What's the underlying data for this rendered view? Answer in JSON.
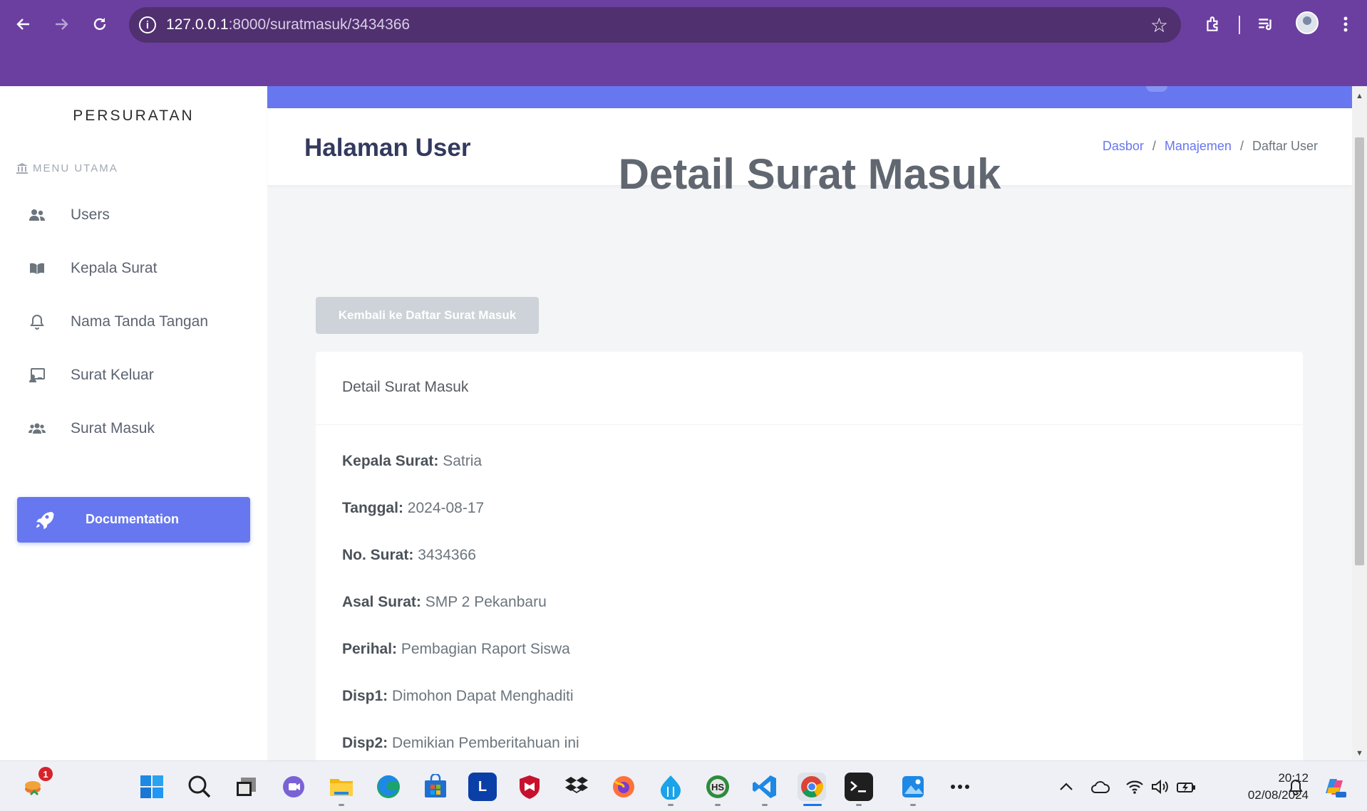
{
  "browser": {
    "url_host": "127.0.0.1",
    "url_path": ":8000/suratmasuk/3434366"
  },
  "sidebar": {
    "brand": "PERSURATAN",
    "menu_title": "MENU UTAMA",
    "items": [
      {
        "label": "Users",
        "icon": "users-icon"
      },
      {
        "label": "Kepala Surat",
        "icon": "book-icon"
      },
      {
        "label": "Nama Tanda Tangan",
        "icon": "bell-icon"
      },
      {
        "label": "Surat Keluar",
        "icon": "chalkboard-icon"
      },
      {
        "label": "Surat Masuk",
        "icon": "users-group-icon"
      }
    ],
    "doc_button": "Documentation"
  },
  "header": {
    "title": "Halaman User",
    "breadcrumb": [
      "Dasbor",
      "Manajemen",
      "Daftar User"
    ]
  },
  "main": {
    "title": "Detail Surat Masuk",
    "back_button": "Kembali ke Daftar Surat Masuk",
    "card_header": "Detail Surat Masuk",
    "fields": [
      {
        "label": "Kepala Surat:",
        "value": "Satria"
      },
      {
        "label": "Tanggal:",
        "value": "2024-08-17"
      },
      {
        "label": "No. Surat:",
        "value": "3434366"
      },
      {
        "label": "Asal Surat:",
        "value": "SMP 2 Pekanbaru"
      },
      {
        "label": "Perihal:",
        "value": "Pembagian Raport Siswa"
      },
      {
        "label": "Disp1:",
        "value": "Dimohon Dapat Menghaditi"
      },
      {
        "label": "Disp2:",
        "value": "Demikian Pemberitahuan ini"
      }
    ]
  },
  "taskbar": {
    "notification_badge": "1",
    "time": "20:12",
    "date": "02/08/2024"
  },
  "colors": {
    "browser_chrome": "#6b3fa0",
    "accent": "#6777ef",
    "back_button": "#cdd3d8"
  }
}
